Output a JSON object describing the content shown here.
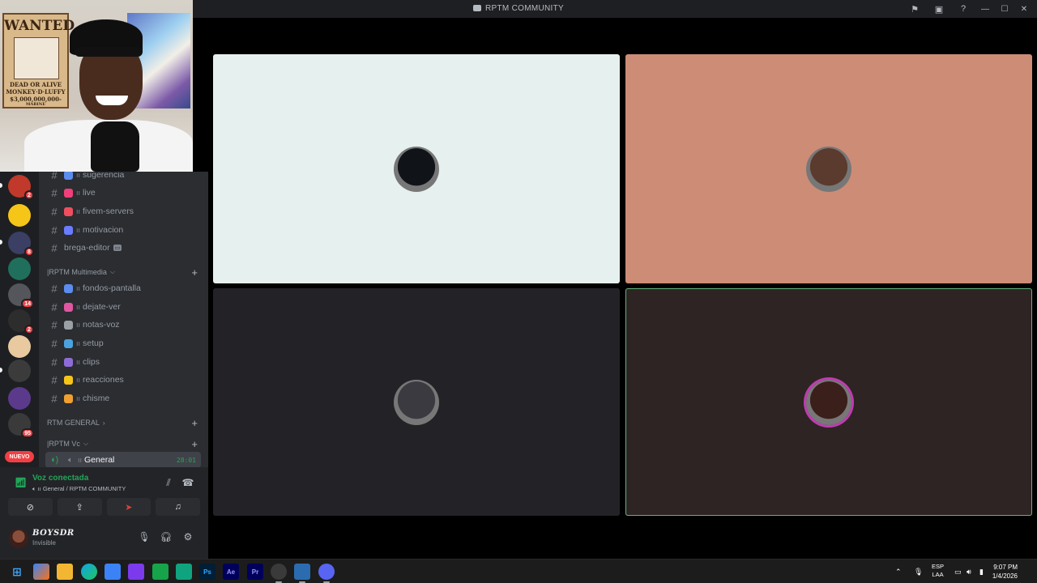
{
  "window": {
    "title": "RPTM COMMUNITY",
    "controls": [
      "minimize",
      "maximize",
      "close"
    ]
  },
  "webcam_overlay": {
    "poster_title": "WANTED",
    "poster_line1": "DEAD OR ALIVE",
    "poster_line2": "MONKEY·D·LUFFY",
    "poster_bounty": "$3,000,000,000-",
    "poster_footer": "MARINE"
  },
  "servers": [
    {
      "badge": "2",
      "color": "#c0392b"
    },
    {
      "badge": "",
      "color": "#f5c518"
    },
    {
      "badge": "8",
      "color": "#3a3f63"
    },
    {
      "badge": "",
      "color": "#1f6f5c"
    },
    {
      "badge": "14",
      "color": "#55565c"
    },
    {
      "badge": "2",
      "color": "#2d2d2d"
    },
    {
      "badge": "",
      "color": "#e8c9a0"
    },
    {
      "badge": "",
      "color": "#3b3b3b"
    },
    {
      "badge": "",
      "color": "#5b3a8c"
    },
    {
      "badge": "95",
      "color": "#3a3a3a"
    }
  ],
  "new_label": "NUEVO",
  "channels": {
    "top": [
      {
        "name": "sugerencia",
        "emoji_color": "#5b8def"
      },
      {
        "name": "live",
        "emoji_color": "#f23f7a"
      },
      {
        "name": "fivem-servers",
        "emoji_color": "#f04e5e"
      },
      {
        "name": "motivacion",
        "emoji_color": "#6a7dff"
      },
      {
        "name": "brega-editor",
        "emoji_color": ""
      }
    ],
    "category_multimedia": "RPTM Multimedia",
    "multimedia": [
      {
        "name": "fondos-pantalla",
        "emoji_color": "#5b8def"
      },
      {
        "name": "dejate-ver",
        "emoji_color": "#e056a0"
      },
      {
        "name": "notas-voz",
        "emoji_color": "#9aa0a6"
      },
      {
        "name": "setup",
        "emoji_color": "#4aa3df"
      },
      {
        "name": "clips",
        "emoji_color": "#8e6cd8"
      },
      {
        "name": "reacciones",
        "emoji_color": "#f5c518"
      },
      {
        "name": "chisme",
        "emoji_color": "#f0a030"
      }
    ],
    "category_general": "RTM GENERAL",
    "category_vc": "RPTM Vc",
    "voice_channel": {
      "name": "General",
      "timer": "28:01"
    }
  },
  "voice_panel": {
    "status": "Voz conectada",
    "location": "General / RPTM COMMUNITY"
  },
  "user": {
    "name": "BOYSDR",
    "status": "Invisible"
  },
  "stage": {
    "tiles": [
      {
        "bg": "#e6f1ef",
        "avatar": "#101418",
        "speaking": false
      },
      {
        "bg": "#cc8c76",
        "avatar": "#5a3b2e",
        "speaking": false
      },
      {
        "bg": "#232327",
        "avatar": "#3b3a40",
        "speaking": false
      },
      {
        "bg": "#2e2424",
        "avatar": "#3b1f1b",
        "speaking": true
      }
    ]
  },
  "taskbar": {
    "lang": "ESP",
    "lang_sub": "LAA",
    "time": "9:07 PM",
    "date": "1/4/2026",
    "apps": [
      "Ps",
      "Ae",
      "Pr"
    ]
  }
}
